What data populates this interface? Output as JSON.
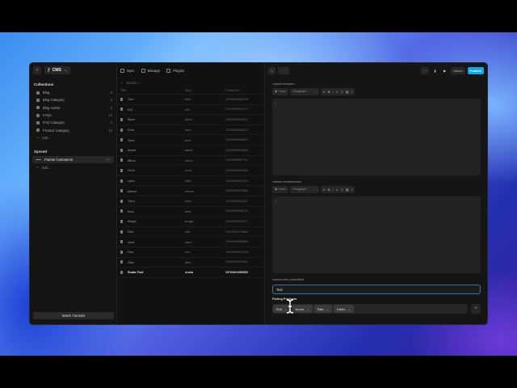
{
  "sidebar": {
    "cms_label": "CMS",
    "collections_heading": "Collections",
    "collections": [
      {
        "label": "Blog",
        "count": "8"
      },
      {
        "label": "Blog Category",
        "count": "3"
      },
      {
        "label": "Blog Author",
        "count": "2"
      },
      {
        "label": "FAQs",
        "count": "24"
      },
      {
        "label": "FAQ Category",
        "count": "4"
      },
      {
        "label": "Product Category",
        "count": "10"
      }
    ],
    "add_label": "Add...",
    "synced_heading": "Synced",
    "synced": [
      {
        "label": "Framer Commerce",
        "count": "17"
      }
    ],
    "synced_add_label": "Add...",
    "watch_button": "Watch Tutorials"
  },
  "list": {
    "tabs": [
      {
        "label": "Sync"
      },
      {
        "label": "Manage"
      },
      {
        "label": "Plugins"
      }
    ],
    "search_placeholder": "Search...",
    "columns": [
      "Title",
      "Slug",
      "Product ID"
    ],
    "rows": [
      {
        "title": "Tom",
        "slug": "tom",
        "id": "15766599482153"
      },
      {
        "title": "Erit",
        "slug": "erit",
        "id": "15760599581272"
      },
      {
        "title": "Bjorn",
        "slug": "bjorn",
        "id": "15760599569537"
      },
      {
        "title": "Einn",
        "slug": "einn",
        "id": "15760599630873"
      },
      {
        "title": "Tove",
        "slug": "tove",
        "id": "15760599886407"
      },
      {
        "title": "Asbel",
        "slug": "asbel",
        "id": "15760599504809"
      },
      {
        "title": "Mirco",
        "slug": "mirco",
        "id": "15760599557751"
      },
      {
        "title": "Orrio",
        "slug": "orrio",
        "id": "15760599481881"
      },
      {
        "title": "Lyria",
        "slug": "lyria",
        "id": "15760599831969"
      },
      {
        "title": "Maren",
        "slug": "maren",
        "id": "15760599575965"
      },
      {
        "title": "Torio",
        "slug": "torio",
        "id": "15760599440437"
      },
      {
        "title": "Alva",
        "slug": "alva",
        "id": "15760599568745"
      },
      {
        "title": "Brage",
        "slug": "brage",
        "id": "15760599633871"
      },
      {
        "title": "Elia",
        "slug": "elia",
        "id": "15760599778865"
      },
      {
        "title": "Vara",
        "slug": "vara",
        "id": "15760599880589"
      },
      {
        "title": "Rea",
        "slug": "rea",
        "id": "15760599474705"
      },
      {
        "title": "Sten",
        "slug": "sten",
        "id": "15760599702981"
      },
      {
        "title": "Svala Test",
        "slug": "svala",
        "id": "15760601098565",
        "bold": true
      }
    ]
  },
  "editor": {
    "saved_label": "Saved",
    "publish_label": "Publish",
    "field1_label": "custom.features",
    "field2_label": "custom.includedrems",
    "insert_label": "Insert",
    "paragraph_label": "Paragraph",
    "field3_label": "custom.text_matchfield",
    "text_value": "Test",
    "field4_label": "Pairing Products",
    "tags": [
      "Eldr",
      "Norna",
      "Rikk",
      "Dalen"
    ]
  }
}
